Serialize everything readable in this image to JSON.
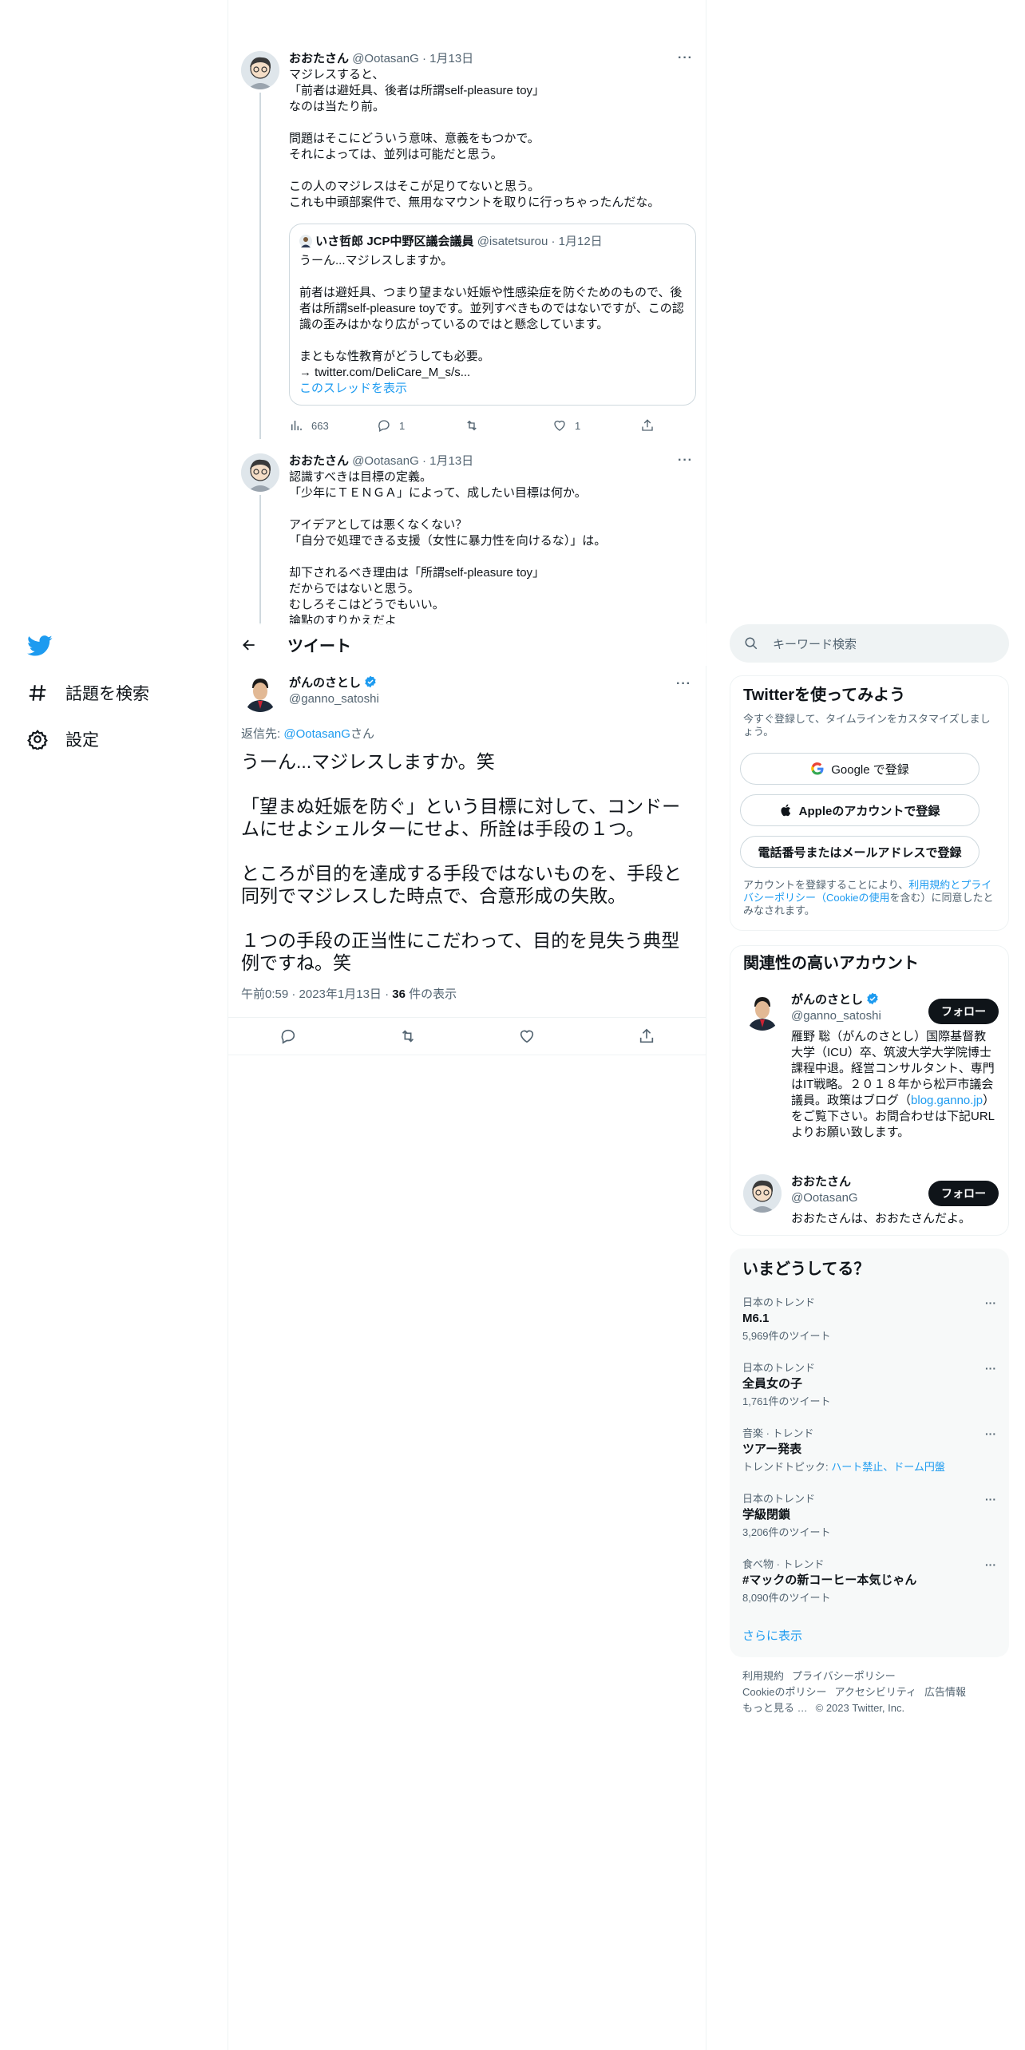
{
  "nav": {
    "explore_label": "話題を検索",
    "settings_label": "設定"
  },
  "thread": [
    {
      "name": "おおたさん",
      "handle": "@OotasanG",
      "sep": "·",
      "date": "1月13日",
      "text": "マジレスすると、\n「前者は避妊具、後者は所謂self-pleasure toy」\nなのは当たり前。\n\n問題はそこにどういう意味、意義をもつかで。\nそれによっては、並列は可能だと思う。\n\nこの人のマジレスはそこが足りてないと思う。\nこれも中頭部案件で、無用なマウントを取りに行っちゃったんだな。",
      "quote": {
        "name": "いさ哲郎 JCP中野区議会議員",
        "handle": "@isatetsurou",
        "sep": "·",
        "date": "1月12日",
        "text": "うーん...マジレスしますか。\n\n前者は避妊具、つまり望まない妊娠や性感染症を防ぐためのもので、後者は所謂self-pleasure toyです。並列すべきものではないですが、この認識の歪みはかなり広がっているのではと懸念しています。\n\nまともな性教育がどうしても必要。\n→ twitter.com/DeliCare_M_s/s...",
        "show_thread": "このスレッドを表示"
      },
      "views": "663",
      "replies": "1",
      "retweets": "",
      "likes": "1"
    },
    {
      "name": "おおたさん",
      "handle": "@OotasanG",
      "sep": "·",
      "date": "1月13日",
      "text": "認識すべきは目標の定義。\n「少年にＴＥＮＧＡ」によって、成したい目標は何か。\n\nアイデアとしては悪くなくない？\n「自分で処理できる支援（女性に暴力性を向けるな）」は。\n\n却下されるべき理由は「所謂self-pleasure toy」\nだからではないと思う。\nむしろそこはどうでもいい。\n論點のすりかえだよ"
    }
  ],
  "topbar": {
    "title": "ツイート"
  },
  "main_tweet": {
    "name": "がんのさとし",
    "handle": "@ganno_satoshi",
    "reply_prefix": "返信先: ",
    "reply_to": "@OotasanG",
    "reply_suffix": "さん",
    "text": "うーん...マジレスしますか。笑\n\n「望まぬ妊娠を防ぐ」という目標に対して、コンドームにせよシェルターにせよ、所詮は手段の１つ。\n\nところが目的を達成する手段ではないものを、手段と同列でマジレスした時点で、合意形成の失敗。\n\n１つの手段の正当性にこだわって、目的を見失う典型例ですね。笑",
    "time": "午前0:59 · 2023年1月13日 · ",
    "views_count": "36",
    "views_label": " 件の表示"
  },
  "search": {
    "placeholder": "キーワード検索"
  },
  "signup": {
    "title": "Twitterを使ってみよう",
    "subtitle": "今すぐ登録して、タイムラインをカスタマイズしましょう。",
    "google": "Google で登録",
    "apple": "Appleのアカウントで登録",
    "phone": "電話番号またはメールアドレスで登録",
    "legal_1": "アカウントを登録することにより、",
    "legal_link": "利用規約とプライバシーポリシー（Cookieの使用",
    "legal_2": "を含む）に同意したとみなされます。"
  },
  "related": {
    "title": "関連性の高いアカウント",
    "accounts": [
      {
        "name": "がんのさとし",
        "handle": "@ganno_satoshi",
        "follow": "フォロー",
        "bio_1": "雁野 聡（がんのさとし）国際基督教大学（ICU）卒、筑波大学大学院博士課程中退。経営コンサルタント、専門はIT戦略。２０１８年から松戸市議会議員。政策はブログ（",
        "bio_link": "blog.ganno.jp",
        "bio_2": "）をご覧下さい。お問合わせは下記URLよりお願い致します。"
      },
      {
        "name": "おおたさん",
        "handle": "@OotasanG",
        "follow": "フォロー",
        "bio": "おおたさんは、おおたさんだよ。"
      }
    ]
  },
  "trends": {
    "title": "いまどうしてる？",
    "items": [
      {
        "meta": "日本のトレンド",
        "name": "M6.1",
        "count": "5,969件のツイート"
      },
      {
        "meta": "日本のトレンド",
        "name": "全員女の子",
        "count": "1,761件のツイート"
      },
      {
        "meta": "音楽 · トレンド",
        "name": "ツアー発表",
        "topic_prefix": "トレンドトピック: ",
        "topic_links": "ハート禁止、ドーム円盤"
      },
      {
        "meta": "日本のトレンド",
        "name": "学級閉鎖",
        "count": "3,206件のツイート"
      },
      {
        "meta": "食べ物 · トレンド",
        "name": "#マックの新コーヒー本気じゃん",
        "count": "8,090件のツイート"
      }
    ],
    "more": "さらに表示"
  },
  "footer": {
    "terms": "利用規約",
    "privacy": "プライバシーポリシー",
    "cookie": "Cookieのポリシー",
    "accessibility": "アクセシビリティ",
    "ads": "広告情報",
    "more": "もっと見る …",
    "copyright": "© 2023 Twitter, Inc."
  },
  "colors": {
    "accent": "#1d9bf0",
    "text": "#0f1419",
    "secondary": "#536471",
    "border": "#eff3f4"
  }
}
